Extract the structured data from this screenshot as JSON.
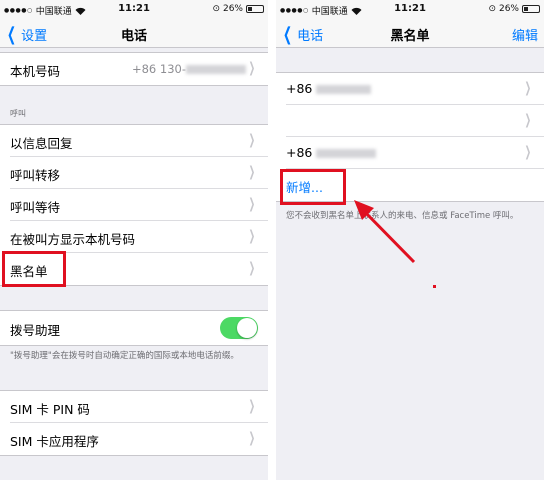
{
  "left_screen": {
    "status": {
      "carrier": "中国联通",
      "time": "11:21",
      "battery": "26%"
    },
    "nav": {
      "back_label": "设置",
      "title": "电话"
    },
    "my_number": {
      "label": "本机号码",
      "value": "+86 130-"
    },
    "calls_header": "呼叫",
    "calls": [
      {
        "label": "以信息回复"
      },
      {
        "label": "呼叫转移"
      },
      {
        "label": "呼叫等待"
      },
      {
        "label": "在被叫方显示本机号码"
      },
      {
        "label": "黑名单"
      }
    ],
    "dial_assist": {
      "label": "拨号助理",
      "enabled": true
    },
    "dial_assist_note": "\"拨号助理\"会在拨号时自动确定正确的国际或本地电话前缀。",
    "sim": [
      {
        "label": "SIM 卡 PIN 码"
      },
      {
        "label": "SIM 卡应用程序"
      }
    ]
  },
  "right_screen": {
    "status": {
      "carrier": "中国联通",
      "time": "11:21",
      "battery": "26%"
    },
    "nav": {
      "back_label": "电话",
      "title": "黑名单",
      "edit_label": "编辑"
    },
    "entries": [
      {
        "prefix": "+86"
      },
      {
        "prefix": ""
      },
      {
        "prefix": "+86"
      }
    ],
    "add_new_label": "新增...",
    "note": "您不会收到黑名单上联系人的来电、信息或 FaceTime 呼叫。"
  },
  "colors": {
    "accent": "#007aff",
    "highlight": "#e01020",
    "toggle_on": "#4cd964",
    "background": "#efeff4"
  }
}
